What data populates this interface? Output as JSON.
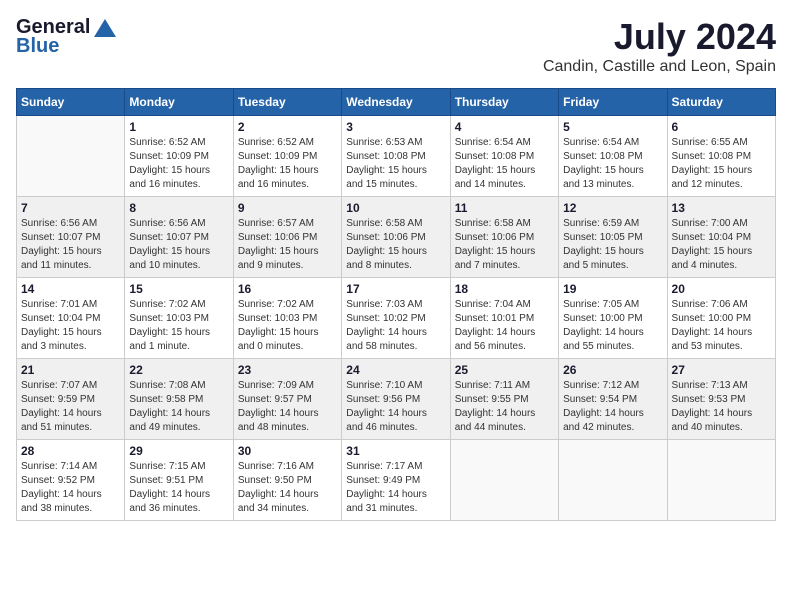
{
  "logo": {
    "general": "General",
    "blue": "Blue"
  },
  "title": {
    "month_year": "July 2024",
    "location": "Candin, Castille and Leon, Spain"
  },
  "headers": [
    "Sunday",
    "Monday",
    "Tuesday",
    "Wednesday",
    "Thursday",
    "Friday",
    "Saturday"
  ],
  "weeks": [
    [
      {
        "day": "",
        "sunrise": "",
        "sunset": "",
        "daylight": ""
      },
      {
        "day": "1",
        "sunrise": "Sunrise: 6:52 AM",
        "sunset": "Sunset: 10:09 PM",
        "daylight": "Daylight: 15 hours and 16 minutes."
      },
      {
        "day": "2",
        "sunrise": "Sunrise: 6:52 AM",
        "sunset": "Sunset: 10:09 PM",
        "daylight": "Daylight: 15 hours and 16 minutes."
      },
      {
        "day": "3",
        "sunrise": "Sunrise: 6:53 AM",
        "sunset": "Sunset: 10:08 PM",
        "daylight": "Daylight: 15 hours and 15 minutes."
      },
      {
        "day": "4",
        "sunrise": "Sunrise: 6:54 AM",
        "sunset": "Sunset: 10:08 PM",
        "daylight": "Daylight: 15 hours and 14 minutes."
      },
      {
        "day": "5",
        "sunrise": "Sunrise: 6:54 AM",
        "sunset": "Sunset: 10:08 PM",
        "daylight": "Daylight: 15 hours and 13 minutes."
      },
      {
        "day": "6",
        "sunrise": "Sunrise: 6:55 AM",
        "sunset": "Sunset: 10:08 PM",
        "daylight": "Daylight: 15 hours and 12 minutes."
      }
    ],
    [
      {
        "day": "7",
        "sunrise": "Sunrise: 6:56 AM",
        "sunset": "Sunset: 10:07 PM",
        "daylight": "Daylight: 15 hours and 11 minutes."
      },
      {
        "day": "8",
        "sunrise": "Sunrise: 6:56 AM",
        "sunset": "Sunset: 10:07 PM",
        "daylight": "Daylight: 15 hours and 10 minutes."
      },
      {
        "day": "9",
        "sunrise": "Sunrise: 6:57 AM",
        "sunset": "Sunset: 10:06 PM",
        "daylight": "Daylight: 15 hours and 9 minutes."
      },
      {
        "day": "10",
        "sunrise": "Sunrise: 6:58 AM",
        "sunset": "Sunset: 10:06 PM",
        "daylight": "Daylight: 15 hours and 8 minutes."
      },
      {
        "day": "11",
        "sunrise": "Sunrise: 6:58 AM",
        "sunset": "Sunset: 10:06 PM",
        "daylight": "Daylight: 15 hours and 7 minutes."
      },
      {
        "day": "12",
        "sunrise": "Sunrise: 6:59 AM",
        "sunset": "Sunset: 10:05 PM",
        "daylight": "Daylight: 15 hours and 5 minutes."
      },
      {
        "day": "13",
        "sunrise": "Sunrise: 7:00 AM",
        "sunset": "Sunset: 10:04 PM",
        "daylight": "Daylight: 15 hours and 4 minutes."
      }
    ],
    [
      {
        "day": "14",
        "sunrise": "Sunrise: 7:01 AM",
        "sunset": "Sunset: 10:04 PM",
        "daylight": "Daylight: 15 hours and 3 minutes."
      },
      {
        "day": "15",
        "sunrise": "Sunrise: 7:02 AM",
        "sunset": "Sunset: 10:03 PM",
        "daylight": "Daylight: 15 hours and 1 minute."
      },
      {
        "day": "16",
        "sunrise": "Sunrise: 7:02 AM",
        "sunset": "Sunset: 10:03 PM",
        "daylight": "Daylight: 15 hours and 0 minutes."
      },
      {
        "day": "17",
        "sunrise": "Sunrise: 7:03 AM",
        "sunset": "Sunset: 10:02 PM",
        "daylight": "Daylight: 14 hours and 58 minutes."
      },
      {
        "day": "18",
        "sunrise": "Sunrise: 7:04 AM",
        "sunset": "Sunset: 10:01 PM",
        "daylight": "Daylight: 14 hours and 56 minutes."
      },
      {
        "day": "19",
        "sunrise": "Sunrise: 7:05 AM",
        "sunset": "Sunset: 10:00 PM",
        "daylight": "Daylight: 14 hours and 55 minutes."
      },
      {
        "day": "20",
        "sunrise": "Sunrise: 7:06 AM",
        "sunset": "Sunset: 10:00 PM",
        "daylight": "Daylight: 14 hours and 53 minutes."
      }
    ],
    [
      {
        "day": "21",
        "sunrise": "Sunrise: 7:07 AM",
        "sunset": "Sunset: 9:59 PM",
        "daylight": "Daylight: 14 hours and 51 minutes."
      },
      {
        "day": "22",
        "sunrise": "Sunrise: 7:08 AM",
        "sunset": "Sunset: 9:58 PM",
        "daylight": "Daylight: 14 hours and 49 minutes."
      },
      {
        "day": "23",
        "sunrise": "Sunrise: 7:09 AM",
        "sunset": "Sunset: 9:57 PM",
        "daylight": "Daylight: 14 hours and 48 minutes."
      },
      {
        "day": "24",
        "sunrise": "Sunrise: 7:10 AM",
        "sunset": "Sunset: 9:56 PM",
        "daylight": "Daylight: 14 hours and 46 minutes."
      },
      {
        "day": "25",
        "sunrise": "Sunrise: 7:11 AM",
        "sunset": "Sunset: 9:55 PM",
        "daylight": "Daylight: 14 hours and 44 minutes."
      },
      {
        "day": "26",
        "sunrise": "Sunrise: 7:12 AM",
        "sunset": "Sunset: 9:54 PM",
        "daylight": "Daylight: 14 hours and 42 minutes."
      },
      {
        "day": "27",
        "sunrise": "Sunrise: 7:13 AM",
        "sunset": "Sunset: 9:53 PM",
        "daylight": "Daylight: 14 hours and 40 minutes."
      }
    ],
    [
      {
        "day": "28",
        "sunrise": "Sunrise: 7:14 AM",
        "sunset": "Sunset: 9:52 PM",
        "daylight": "Daylight: 14 hours and 38 minutes."
      },
      {
        "day": "29",
        "sunrise": "Sunrise: 7:15 AM",
        "sunset": "Sunset: 9:51 PM",
        "daylight": "Daylight: 14 hours and 36 minutes."
      },
      {
        "day": "30",
        "sunrise": "Sunrise: 7:16 AM",
        "sunset": "Sunset: 9:50 PM",
        "daylight": "Daylight: 14 hours and 34 minutes."
      },
      {
        "day": "31",
        "sunrise": "Sunrise: 7:17 AM",
        "sunset": "Sunset: 9:49 PM",
        "daylight": "Daylight: 14 hours and 31 minutes."
      },
      {
        "day": "",
        "sunrise": "",
        "sunset": "",
        "daylight": ""
      },
      {
        "day": "",
        "sunrise": "",
        "sunset": "",
        "daylight": ""
      },
      {
        "day": "",
        "sunrise": "",
        "sunset": "",
        "daylight": ""
      }
    ]
  ]
}
